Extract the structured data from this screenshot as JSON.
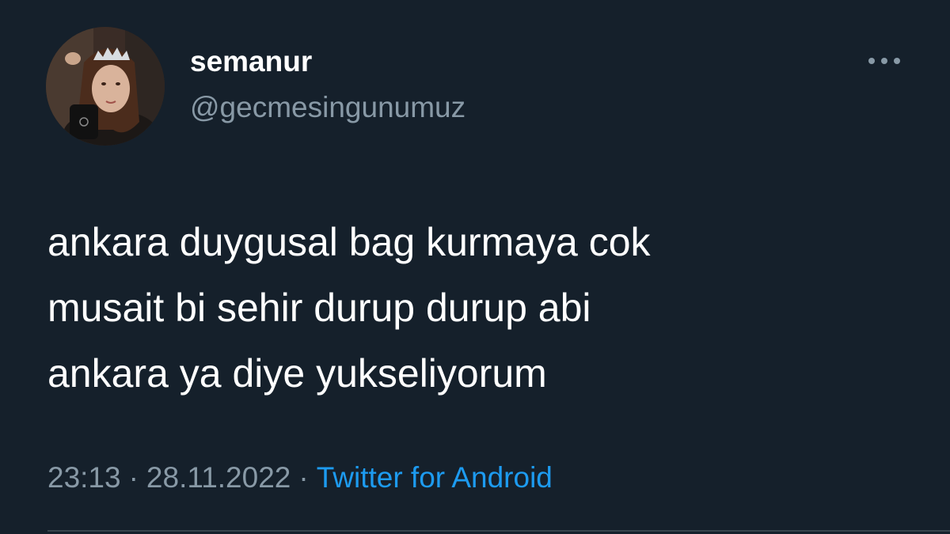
{
  "author": {
    "display_name": "semanur",
    "handle": "@gecmesingunumuz",
    "avatar_icon": "profile-photo"
  },
  "more_icon": "more-horizontal-icon",
  "tweet": {
    "lines": [
      "ankara duygusal bag kurmaya cok",
      "musait bi sehir durup durup abi",
      "ankara ya diye yukseliyorum"
    ]
  },
  "meta": {
    "time": "23:13",
    "separator_1": "·",
    "date": "28.11.2022",
    "separator_2": "·",
    "source": "Twitter for Android"
  },
  "colors": {
    "background": "#15202b",
    "text_primary": "#ffffff",
    "text_secondary": "#8899a6",
    "link": "#1d9bf0"
  }
}
